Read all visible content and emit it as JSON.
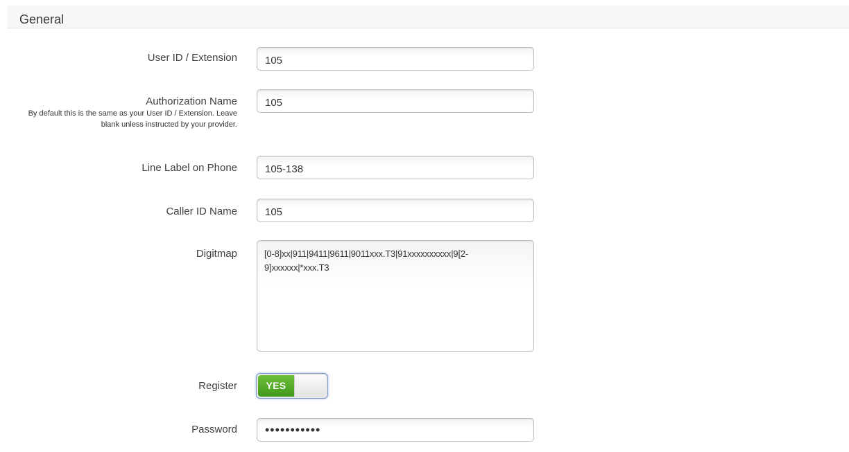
{
  "section": {
    "title": "General"
  },
  "fields": {
    "user_id": {
      "label": "User ID / Extension",
      "value": "105"
    },
    "auth_name": {
      "label": "Authorization Name",
      "help": "By default this is the same as your User ID / Extension. Leave blank unless instructed by your provider.",
      "value": "105"
    },
    "line_label": {
      "label": "Line Label on Phone",
      "value": "105-138"
    },
    "caller_id": {
      "label": "Caller ID Name",
      "value": "105"
    },
    "digitmap": {
      "label": "Digitmap",
      "value": "[0-8]xx|911|9411|9611|9011xxx.T3|91xxxxxxxxxx|9[2-9]xxxxxx|*xxx.T3"
    },
    "register": {
      "label": "Register",
      "state_label": "YES",
      "on": true
    },
    "password": {
      "label": "Password",
      "value": "•••••••••••"
    }
  }
}
